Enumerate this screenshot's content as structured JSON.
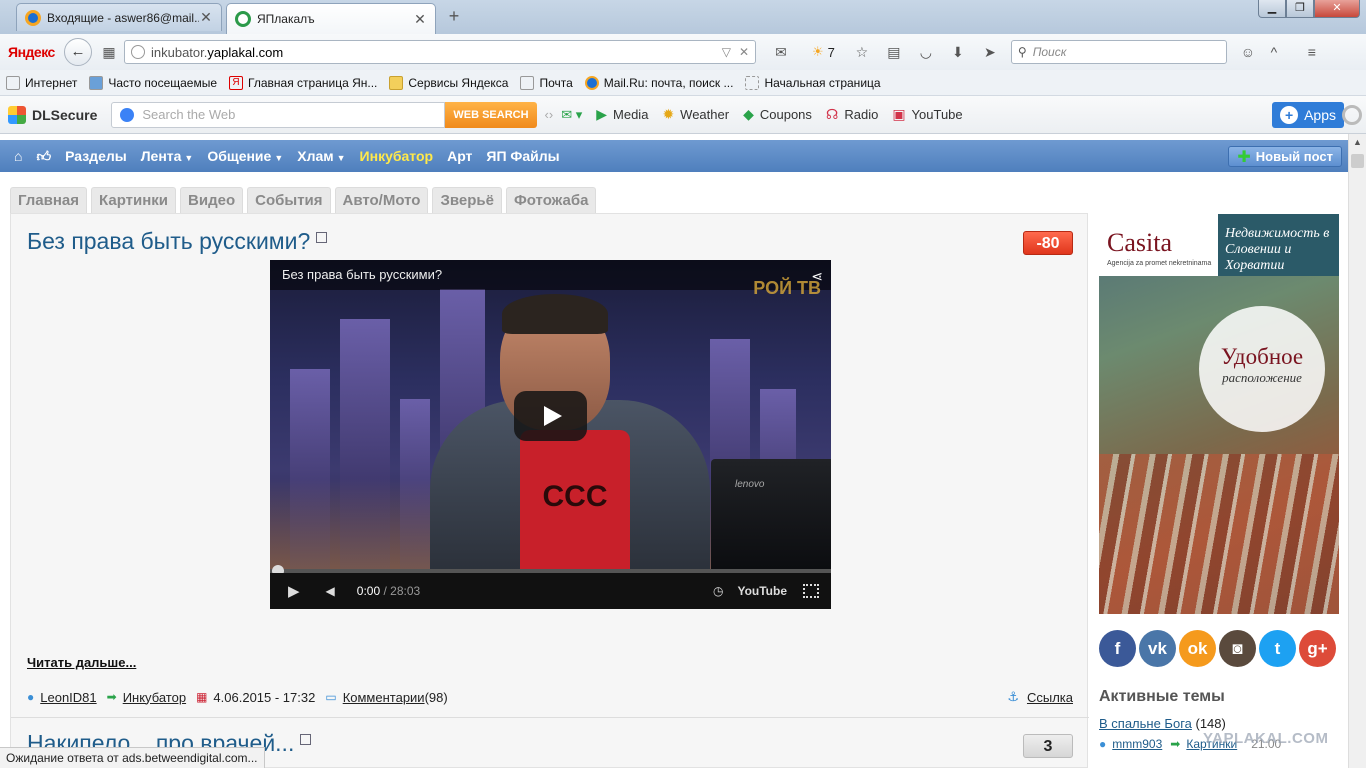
{
  "browser": {
    "tabs": [
      {
        "title": "Входящие - aswer86@mail...",
        "active": false
      },
      {
        "title": "ЯПлакалъ",
        "active": true
      }
    ],
    "new_tab": "+",
    "window_buttons": {
      "minimize": "▁",
      "maximize": "❐",
      "close": "✕"
    },
    "yandex_logo": "Яндекс",
    "url_prefix": "inkubator.",
    "url_domain": "yaplakal.com",
    "weather_temp": "7",
    "search_placeholder": "Поиск",
    "bookmarks": [
      "Интернет",
      "Часто посещаемые",
      "Главная страница Ян...",
      "Сервисы Яндекса",
      "Почта",
      "Mail.Ru: почта, поиск ...",
      "Начальная страница"
    ]
  },
  "dlbar": {
    "logo": "DLSecure",
    "search_placeholder": "Search the Web",
    "web_search": "WEB SEARCH",
    "items": [
      "Media",
      "Weather",
      "Coupons",
      "Radio",
      "YouTube"
    ],
    "apps": "Apps"
  },
  "sitenav": {
    "items": [
      "Разделы",
      "Лента",
      "Общение",
      "Хлам",
      "Инкубатор",
      "Арт",
      "ЯП Файлы"
    ],
    "new_post": "Новый пост"
  },
  "categories": [
    "Главная",
    "Картинки",
    "Видео",
    "События",
    "Авто/Мото",
    "Зверьё",
    "Фотожаба"
  ],
  "post1": {
    "title": "Без права быть русскими?",
    "rating": "-80",
    "video_title": "Без права быть русскими?",
    "video_brand": "РОЙ ТВ",
    "shirt_text": "ССС",
    "laptop_text": "lenovo",
    "time_current": "0:00",
    "time_total": " / 28:03",
    "youtube_label": "YouTube",
    "read_more": "Читать дальше...",
    "author": "LeonID81",
    "section": "Инкубатор",
    "date": "4.06.2015 - 17:32",
    "comments_label": "Комментарии",
    "comments_count": " (98)",
    "link_label": "Ссылка"
  },
  "post2": {
    "title": "Накипело... про врачей...",
    "rating": "3"
  },
  "ad": {
    "brand": "Casita",
    "brand_sub": "Agencija za promet nekretninama",
    "slogan": "Недвижимость в Словении и Хорватии",
    "circle_big": "Удобное",
    "circle_small": "расположение"
  },
  "sidebar": {
    "active_heading": "Активные темы",
    "topic_title": "В спальне Бога",
    "topic_count": " (148)",
    "topic_user": "mmm903",
    "topic_section": "Картинки",
    "topic_time": "21:00",
    "watermark": "YAPLAKAL.COM"
  },
  "status_text": "Ожидание ответа от ads.betweendigital.com..."
}
